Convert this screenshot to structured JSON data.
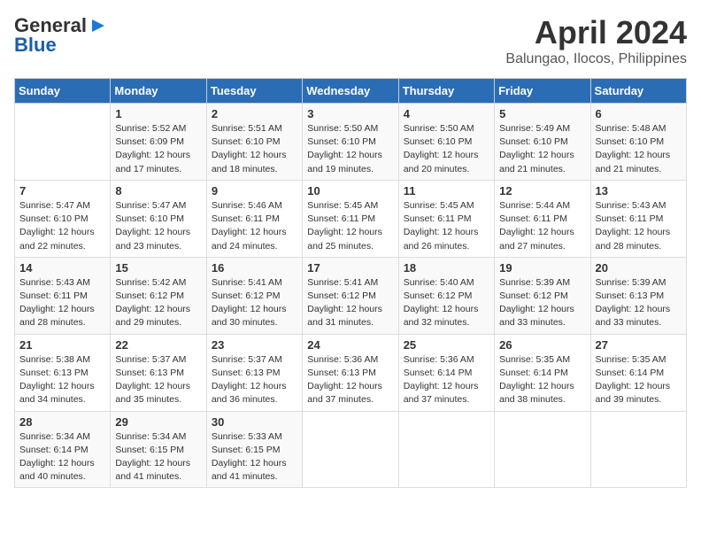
{
  "header": {
    "logo_line1": "General",
    "logo_line2": "Blue",
    "title": "April 2024",
    "subtitle": "Balungao, Ilocos, Philippines"
  },
  "columns": [
    "Sunday",
    "Monday",
    "Tuesday",
    "Wednesday",
    "Thursday",
    "Friday",
    "Saturday"
  ],
  "weeks": [
    [
      {
        "day": "",
        "info": ""
      },
      {
        "day": "1",
        "info": "Sunrise: 5:52 AM\nSunset: 6:09 PM\nDaylight: 12 hours\nand 17 minutes."
      },
      {
        "day": "2",
        "info": "Sunrise: 5:51 AM\nSunset: 6:10 PM\nDaylight: 12 hours\nand 18 minutes."
      },
      {
        "day": "3",
        "info": "Sunrise: 5:50 AM\nSunset: 6:10 PM\nDaylight: 12 hours\nand 19 minutes."
      },
      {
        "day": "4",
        "info": "Sunrise: 5:50 AM\nSunset: 6:10 PM\nDaylight: 12 hours\nand 20 minutes."
      },
      {
        "day": "5",
        "info": "Sunrise: 5:49 AM\nSunset: 6:10 PM\nDaylight: 12 hours\nand 21 minutes."
      },
      {
        "day": "6",
        "info": "Sunrise: 5:48 AM\nSunset: 6:10 PM\nDaylight: 12 hours\nand 21 minutes."
      }
    ],
    [
      {
        "day": "7",
        "info": "Sunrise: 5:47 AM\nSunset: 6:10 PM\nDaylight: 12 hours\nand 22 minutes."
      },
      {
        "day": "8",
        "info": "Sunrise: 5:47 AM\nSunset: 6:10 PM\nDaylight: 12 hours\nand 23 minutes."
      },
      {
        "day": "9",
        "info": "Sunrise: 5:46 AM\nSunset: 6:11 PM\nDaylight: 12 hours\nand 24 minutes."
      },
      {
        "day": "10",
        "info": "Sunrise: 5:45 AM\nSunset: 6:11 PM\nDaylight: 12 hours\nand 25 minutes."
      },
      {
        "day": "11",
        "info": "Sunrise: 5:45 AM\nSunset: 6:11 PM\nDaylight: 12 hours\nand 26 minutes."
      },
      {
        "day": "12",
        "info": "Sunrise: 5:44 AM\nSunset: 6:11 PM\nDaylight: 12 hours\nand 27 minutes."
      },
      {
        "day": "13",
        "info": "Sunrise: 5:43 AM\nSunset: 6:11 PM\nDaylight: 12 hours\nand 28 minutes."
      }
    ],
    [
      {
        "day": "14",
        "info": "Sunrise: 5:43 AM\nSunset: 6:11 PM\nDaylight: 12 hours\nand 28 minutes."
      },
      {
        "day": "15",
        "info": "Sunrise: 5:42 AM\nSunset: 6:12 PM\nDaylight: 12 hours\nand 29 minutes."
      },
      {
        "day": "16",
        "info": "Sunrise: 5:41 AM\nSunset: 6:12 PM\nDaylight: 12 hours\nand 30 minutes."
      },
      {
        "day": "17",
        "info": "Sunrise: 5:41 AM\nSunset: 6:12 PM\nDaylight: 12 hours\nand 31 minutes."
      },
      {
        "day": "18",
        "info": "Sunrise: 5:40 AM\nSunset: 6:12 PM\nDaylight: 12 hours\nand 32 minutes."
      },
      {
        "day": "19",
        "info": "Sunrise: 5:39 AM\nSunset: 6:12 PM\nDaylight: 12 hours\nand 33 minutes."
      },
      {
        "day": "20",
        "info": "Sunrise: 5:39 AM\nSunset: 6:13 PM\nDaylight: 12 hours\nand 33 minutes."
      }
    ],
    [
      {
        "day": "21",
        "info": "Sunrise: 5:38 AM\nSunset: 6:13 PM\nDaylight: 12 hours\nand 34 minutes."
      },
      {
        "day": "22",
        "info": "Sunrise: 5:37 AM\nSunset: 6:13 PM\nDaylight: 12 hours\nand 35 minutes."
      },
      {
        "day": "23",
        "info": "Sunrise: 5:37 AM\nSunset: 6:13 PM\nDaylight: 12 hours\nand 36 minutes."
      },
      {
        "day": "24",
        "info": "Sunrise: 5:36 AM\nSunset: 6:13 PM\nDaylight: 12 hours\nand 37 minutes."
      },
      {
        "day": "25",
        "info": "Sunrise: 5:36 AM\nSunset: 6:14 PM\nDaylight: 12 hours\nand 37 minutes."
      },
      {
        "day": "26",
        "info": "Sunrise: 5:35 AM\nSunset: 6:14 PM\nDaylight: 12 hours\nand 38 minutes."
      },
      {
        "day": "27",
        "info": "Sunrise: 5:35 AM\nSunset: 6:14 PM\nDaylight: 12 hours\nand 39 minutes."
      }
    ],
    [
      {
        "day": "28",
        "info": "Sunrise: 5:34 AM\nSunset: 6:14 PM\nDaylight: 12 hours\nand 40 minutes."
      },
      {
        "day": "29",
        "info": "Sunrise: 5:34 AM\nSunset: 6:15 PM\nDaylight: 12 hours\nand 41 minutes."
      },
      {
        "day": "30",
        "info": "Sunrise: 5:33 AM\nSunset: 6:15 PM\nDaylight: 12 hours\nand 41 minutes."
      },
      {
        "day": "",
        "info": ""
      },
      {
        "day": "",
        "info": ""
      },
      {
        "day": "",
        "info": ""
      },
      {
        "day": "",
        "info": ""
      }
    ]
  ]
}
